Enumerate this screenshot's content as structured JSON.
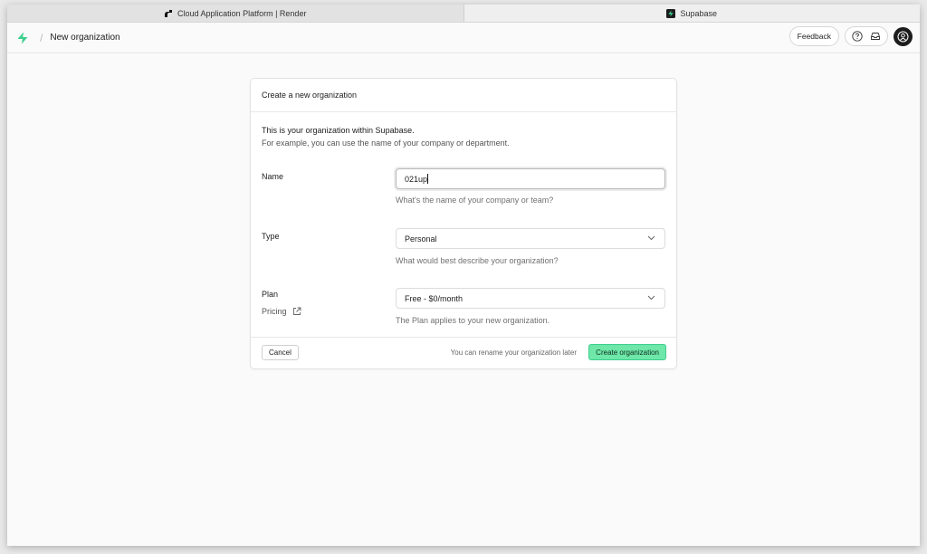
{
  "browser": {
    "tabs": [
      {
        "title": "Cloud Application Platform | Render",
        "icon": "render-logo-icon",
        "active": false
      },
      {
        "title": "Supabase",
        "icon": "supabase-logo-icon",
        "active": true
      }
    ]
  },
  "header": {
    "breadcrumb_sep": "/",
    "breadcrumb": "New organization",
    "feedback_label": "Feedback",
    "brand_color": "#3ECF8E"
  },
  "form": {
    "title": "Create a new organization",
    "intro_line1": "This is your organization within Supabase.",
    "intro_line2": "For example, you can use the name of your company or department.",
    "name": {
      "label": "Name",
      "value": "021up",
      "hint": "What's the name of your company or team?"
    },
    "type": {
      "label": "Type",
      "value": "Personal",
      "hint": "What would best describe your organization?"
    },
    "plan": {
      "label": "Plan",
      "value": "Free - $0/month",
      "hint": "The Plan applies to your new organization.",
      "pricing_link": "Pricing"
    },
    "footer": {
      "cancel_label": "Cancel",
      "note": "You can rename your organization later",
      "submit_label": "Create organization"
    }
  }
}
